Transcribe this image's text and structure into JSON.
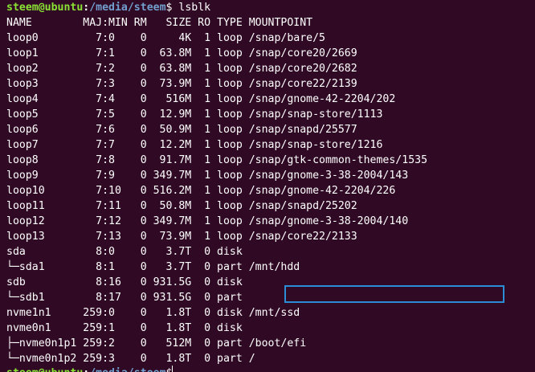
{
  "prompt": {
    "user_host": "steem@ubuntu",
    "separator": ":",
    "path": "/media/steem",
    "symbol": "$",
    "command": " lsblk"
  },
  "header": "NAME        MAJ:MIN RM   SIZE RO TYPE MOUNTPOINT",
  "rows": [
    "loop0         7:0    0     4K  1 loop /snap/bare/5",
    "loop1         7:1    0  63.8M  1 loop /snap/core20/2669",
    "loop2         7:2    0  63.8M  1 loop /snap/core20/2682",
    "loop3         7:3    0  73.9M  1 loop /snap/core22/2139",
    "loop4         7:4    0   516M  1 loop /snap/gnome-42-2204/202",
    "loop5         7:5    0  12.9M  1 loop /snap/snap-store/1113",
    "loop6         7:6    0  50.9M  1 loop /snap/snapd/25577",
    "loop7         7:7    0  12.2M  1 loop /snap/snap-store/1216",
    "loop8         7:8    0  91.7M  1 loop /snap/gtk-common-themes/1535",
    "loop9         7:9    0 349.7M  1 loop /snap/gnome-3-38-2004/143",
    "loop10        7:10   0 516.2M  1 loop /snap/gnome-42-2204/226",
    "loop11        7:11   0  50.8M  1 loop /snap/snapd/25202",
    "loop12        7:12   0 349.7M  1 loop /snap/gnome-3-38-2004/140",
    "loop13        7:13   0  73.9M  1 loop /snap/core22/2133",
    "sda           8:0    0   3.7T  0 disk",
    "└─sda1        8:1    0   3.7T  0 part /mnt/hdd",
    "sdb           8:16   0 931.5G  0 disk",
    "└─sdb1        8:17   0 931.5G  0 part",
    "nvme1n1     259:0    0   1.8T  0 disk /mnt/ssd",
    "nvme0n1     259:1    0   1.8T  0 disk",
    "├─nvme0n1p1 259:2    0   512M  0 part /boot/efi",
    "└─nvme0n1p2 259:3    0   1.8T  0 part /"
  ],
  "colors": {
    "background": "#300a24",
    "user_host": "#8ae234",
    "path": "#729fcf",
    "highlight": "#2a8dd6"
  }
}
